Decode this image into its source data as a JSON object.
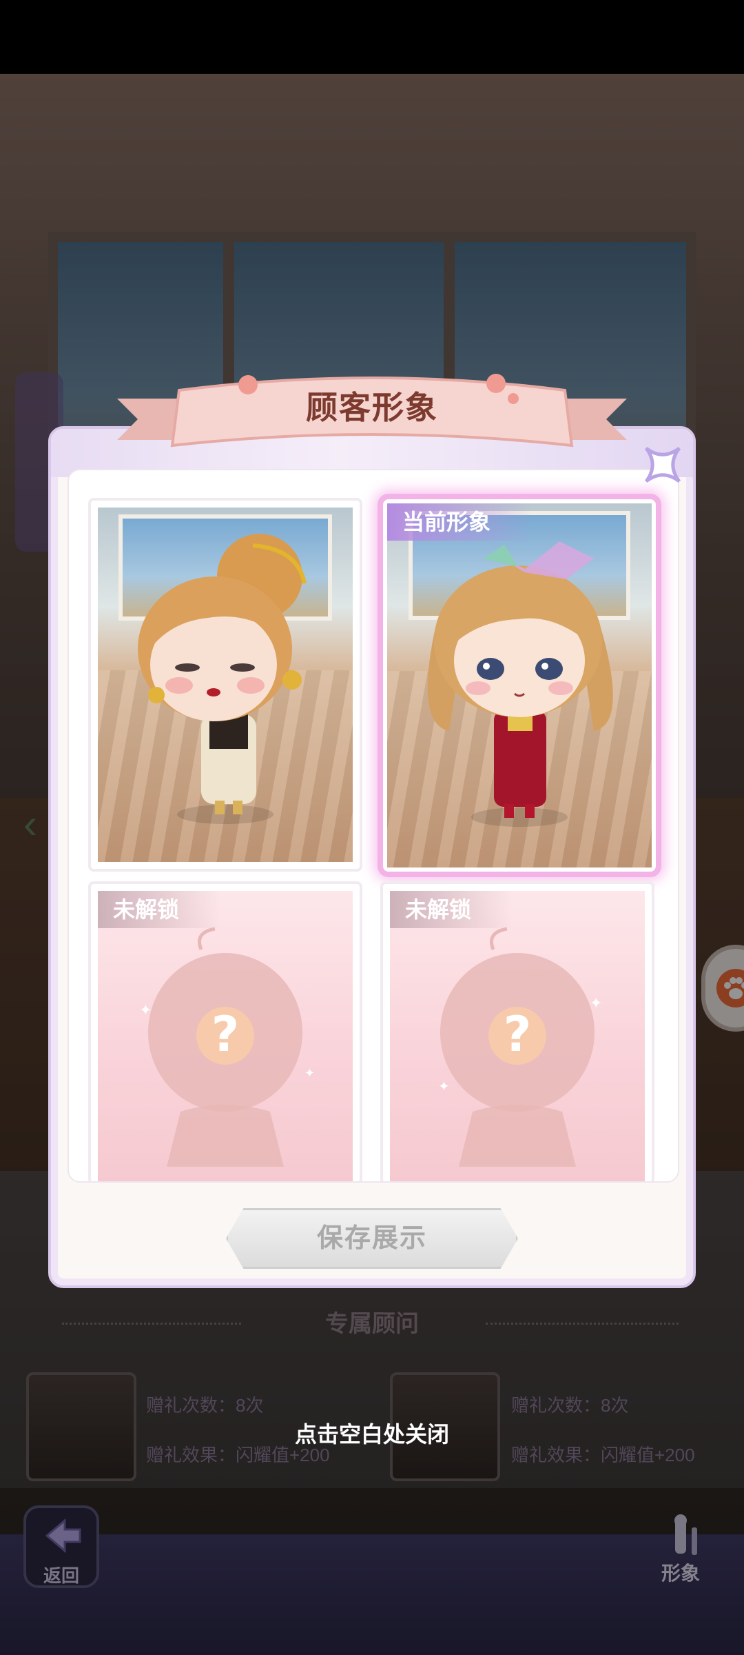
{
  "dialog": {
    "title": "顾客形象",
    "cards": [
      {
        "label": "",
        "state": "unlocked"
      },
      {
        "label": "当前形象",
        "state": "current"
      },
      {
        "label": "未解锁",
        "state": "locked"
      },
      {
        "label": "未解锁",
        "state": "locked"
      }
    ],
    "save_label": "保存展示"
  },
  "hint": "点击空白处关闭",
  "advisor": {
    "title": "专属顾问",
    "items": [
      {
        "gift_count": "赠礼次数：8次",
        "gift_effect": "赠礼效果：闪耀值+200"
      },
      {
        "gift_count": "赠礼次数：8次",
        "gift_effect": "赠礼效果：闪耀值+200"
      }
    ]
  },
  "nav": {
    "back_label": "返回",
    "look_label": "形象"
  },
  "colors": {
    "accent_purple": "#b48ce0",
    "title_brown": "#7c3b2e",
    "ribbon_pink": "#f3c6c4"
  }
}
